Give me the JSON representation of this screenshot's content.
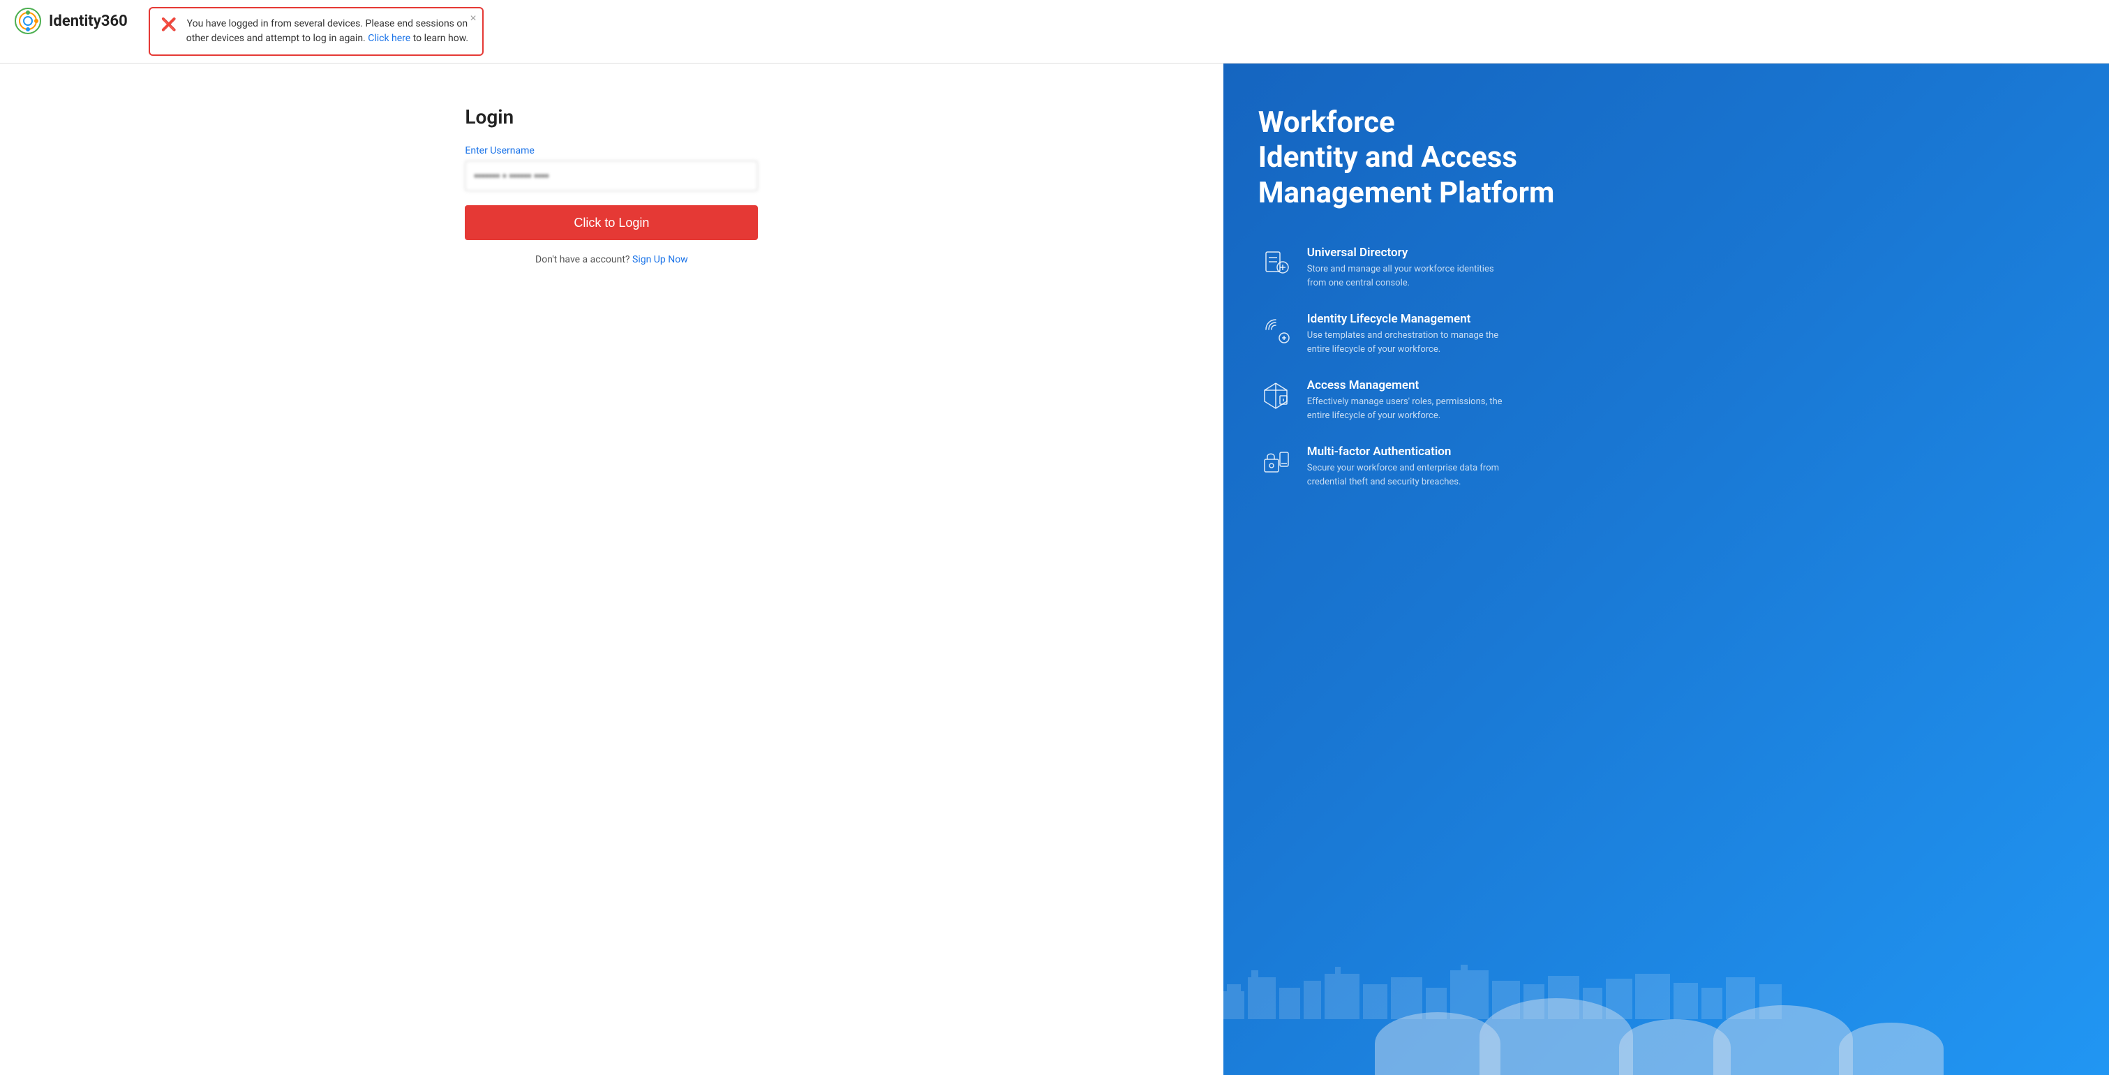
{
  "header": {
    "logo_text": "Identity360"
  },
  "alert": {
    "message_part1": "You have logged in from several devices. Please end sessions on other devices and attempt to log in again.",
    "link_text": "Click here",
    "message_part2": "to learn how.",
    "close_label": "×"
  },
  "login": {
    "title": "Login",
    "field_label": "Enter Username",
    "username_placeholder": "••••••• • •••••• ••••",
    "button_label": "Click to Login",
    "signup_text": "Don't have a account?",
    "signup_link": "Sign Up Now"
  },
  "right_panel": {
    "heading_line1": "Workforce",
    "heading_line2": "Identity and Access",
    "heading_line3": "Management Platform",
    "features": [
      {
        "title": "Universal Directory",
        "description": "Store and manage all your workforce identities from one central console.",
        "icon": "directory"
      },
      {
        "title": "Identity Lifecycle Management",
        "description": "Use templates and orchestration to manage the entire lifecycle of your workforce.",
        "icon": "lifecycle"
      },
      {
        "title": "Access Management",
        "description": "Effectively manage users' roles, permissions, the entire lifecycle of your workforce.",
        "icon": "access"
      },
      {
        "title": "Multi-factor Authentication",
        "description": "Secure your workforce and enterprise data from credential theft and security breaches.",
        "icon": "mfa"
      }
    ]
  }
}
